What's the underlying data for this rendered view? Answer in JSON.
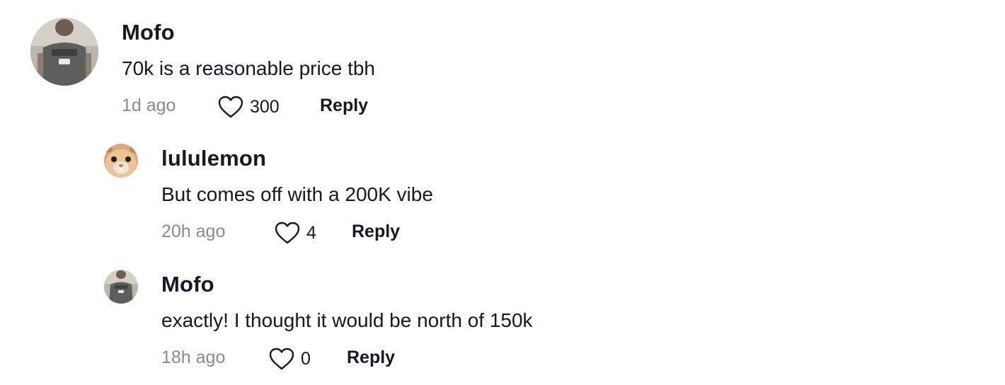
{
  "comments": [
    {
      "username": "Mofo",
      "text": "70k is a reasonable price tbh",
      "time": "1d ago",
      "likes": "300",
      "reply_label": "Reply",
      "avatar": "man-in-gray-tshirt-photo"
    },
    {
      "username": "lululemon",
      "text": "But comes off with a 200K vibe",
      "time": "20h ago",
      "likes": "4",
      "reply_label": "Reply",
      "avatar": "hamster-face-photo"
    },
    {
      "username": "Mofo",
      "text": "exactly! I thought it would be north of 150k",
      "time": "18h ago",
      "likes": "0",
      "reply_label": "Reply",
      "avatar": "man-in-gray-tshirt-photo"
    }
  ],
  "colors": {
    "text_primary": "#161823",
    "text_secondary": "#8a8b91",
    "background": "#ffffff"
  }
}
